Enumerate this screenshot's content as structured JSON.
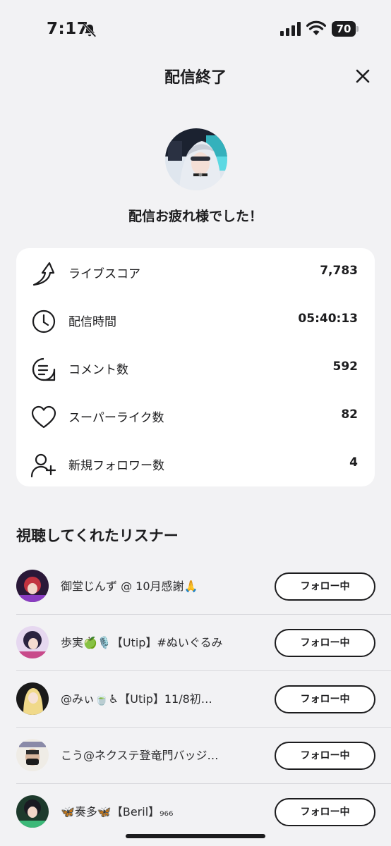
{
  "status_bar": {
    "time": "7:17",
    "battery": "70"
  },
  "header": {
    "title": "配信終了"
  },
  "message": "配信お疲れ様でした！",
  "stats": [
    {
      "icon": "live-score-icon",
      "label": "ライブスコア",
      "value": "7,783"
    },
    {
      "icon": "clock-icon",
      "label": "配信時間",
      "value": "05:40:13"
    },
    {
      "icon": "comment-icon",
      "label": "コメント数",
      "value": "592"
    },
    {
      "icon": "heart-icon",
      "label": "スーパーライク数",
      "value": "82"
    },
    {
      "icon": "add-user-icon",
      "label": "新規フォロワー数",
      "value": "4"
    }
  ],
  "listeners_section": {
    "title": "視聴してくれたリスナー"
  },
  "listeners": [
    {
      "name": "御堂じんず @ 10月感謝🙏",
      "button": "フォロー中"
    },
    {
      "name": "歩実🍏🎙️【Utip】#ぬいぐるみ",
      "button": "フォロー中"
    },
    {
      "name": "@みぃ🍵♿【Utip】11/8初…",
      "button": "フォロー中"
    },
    {
      "name": "こう@ネクステ登竜門バッジ…",
      "button": "フォロー中"
    },
    {
      "name": "🦋奏多🦋【Beril】₉₆₆",
      "button": "フォロー中"
    }
  ],
  "colors": {
    "background": "#f2f2f4",
    "card": "#ffffff",
    "text": "#1c1c1e"
  }
}
